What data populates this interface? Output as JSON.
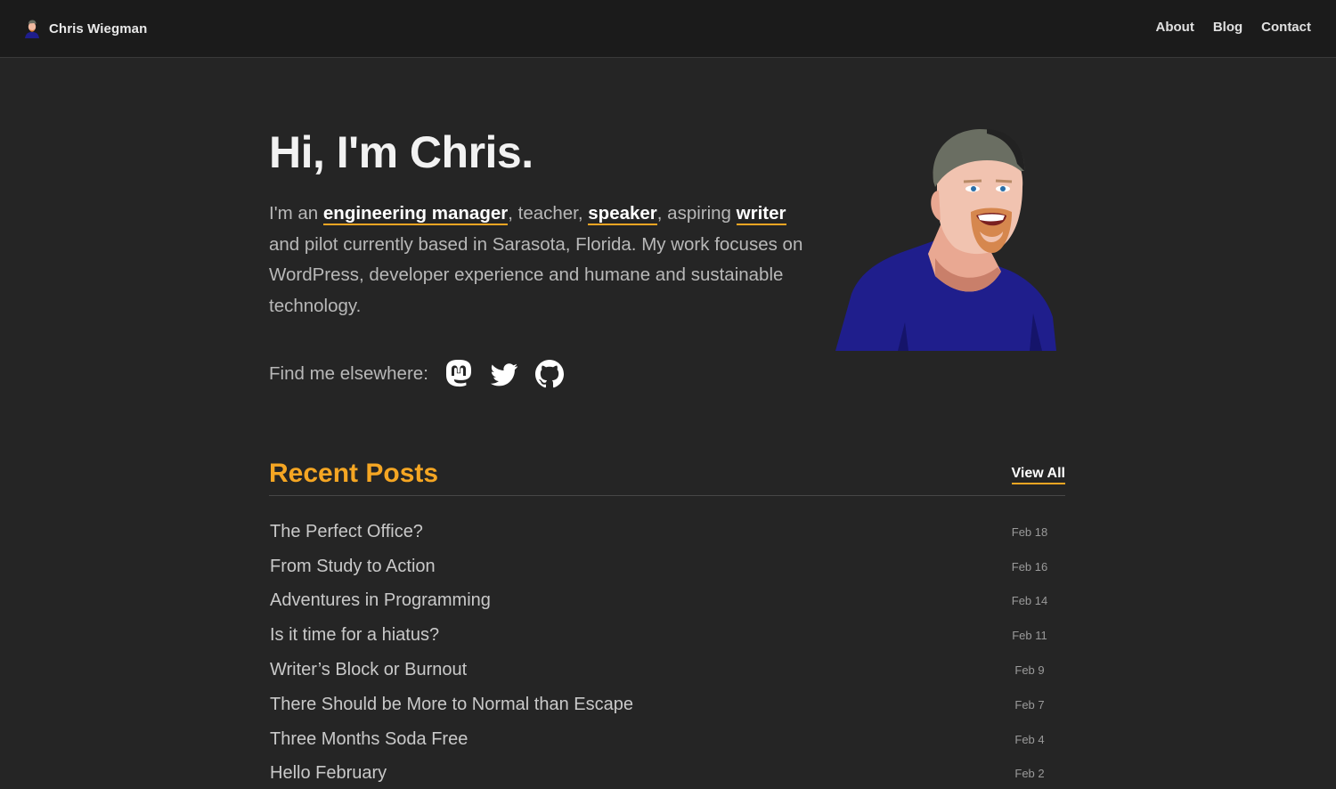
{
  "header": {
    "site_name": "Chris Wiegman",
    "nav": [
      {
        "label": "About"
      },
      {
        "label": "Blog"
      },
      {
        "label": "Contact"
      }
    ]
  },
  "hero": {
    "title": "Hi, I'm Chris.",
    "intro": {
      "t1": "I'm an ",
      "link1": "engineering manager",
      "t2": ", teacher, ",
      "link2": "speaker",
      "t3": ", aspiring ",
      "link3": "writer",
      "t4": " and pilot currently based in Sarasota, Florida. My work focuses on WordPress, developer experience and humane and sustainable technology."
    },
    "elsewhere_label": "Find me elsewhere:",
    "social": [
      {
        "icon": "mastodon-icon"
      },
      {
        "icon": "twitter-icon"
      },
      {
        "icon": "github-icon"
      }
    ]
  },
  "recent_posts": {
    "title": "Recent Posts",
    "view_all": "View All",
    "items": [
      {
        "title": "The Perfect Office?",
        "date": "Feb 18"
      },
      {
        "title": "From Study to Action",
        "date": "Feb 16"
      },
      {
        "title": "Adventures in Programming",
        "date": "Feb 14"
      },
      {
        "title": "Is it time for a hiatus?",
        "date": "Feb 11"
      },
      {
        "title": "Writer’s Block or Burnout",
        "date": "Feb 9"
      },
      {
        "title": "There Should be More to Normal than Escape",
        "date": "Feb 7"
      },
      {
        "title": "Three Months Soda Free",
        "date": "Feb 4"
      },
      {
        "title": "Hello February",
        "date": "Feb 2"
      }
    ]
  },
  "colors": {
    "background": "#252525",
    "header_bg": "#1b1b1b",
    "accent": "#f5a623",
    "shirt": "#1f1e8c"
  }
}
